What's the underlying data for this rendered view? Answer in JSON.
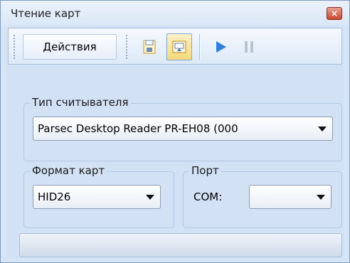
{
  "window": {
    "title": "Чтение карт",
    "close_glyph": "×"
  },
  "toolbar": {
    "actions_label": "Действия",
    "buttons": [
      {
        "name": "save-icon",
        "active": false
      },
      {
        "name": "read-card-icon",
        "active": true
      },
      {
        "name": "play-icon",
        "active": false
      },
      {
        "name": "pause-icon",
        "active": false
      }
    ]
  },
  "reader_type": {
    "label": "Тип считывателя",
    "selected": "Parsec Desktop Reader PR-EH08 (000"
  },
  "card_format": {
    "label": "Формат карт",
    "selected": "HID26"
  },
  "port": {
    "label": "Порт",
    "field_label": "COM:",
    "selected": ""
  },
  "colors": {
    "accent": "#1e74d8",
    "background": "#d2e1f3",
    "close": "#c9472f"
  }
}
